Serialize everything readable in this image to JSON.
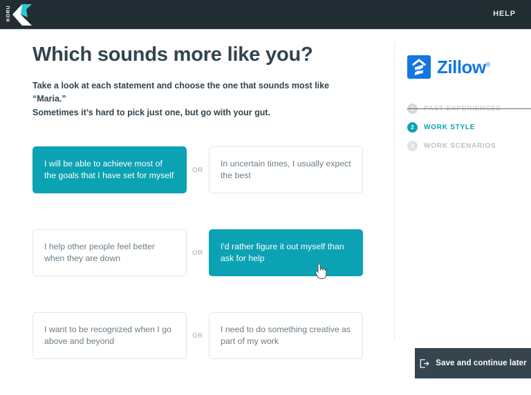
{
  "topbar": {
    "logo_name": "koru-logo",
    "logo_text": "KORU",
    "help_label": "HELP"
  },
  "main": {
    "title": "Which sounds more like you?",
    "subtitle_line1": "Take a look at each statement and choose the one that sounds most like “Maria.”",
    "subtitle_line2": "Sometimes it’s hard to pick just one, but go with your gut.",
    "or_label": "OR",
    "rows": [
      {
        "left": {
          "text": "I will be able to achieve most of the goals that I have set for myself",
          "selected": true
        },
        "right": {
          "text": "In uncertain times, I usually expect the best",
          "selected": false
        }
      },
      {
        "left": {
          "text": "I help other people feel better when they are down",
          "selected": false
        },
        "right": {
          "text": "I'd rather figure it out myself than ask for help",
          "selected": true
        }
      },
      {
        "left": {
          "text": "I want to be recognized when I go above and beyond",
          "selected": false
        },
        "right": {
          "text": "I need to do something creative as part of my work",
          "selected": false
        }
      }
    ]
  },
  "sidebar": {
    "brand_name": "Zillow",
    "brand_registered": "®",
    "steps": [
      {
        "number": "1",
        "label": "PAST EXPERIENCES",
        "state": "done"
      },
      {
        "number": "2",
        "label": "WORK STYLE",
        "state": "current"
      },
      {
        "number": "3",
        "label": "WORK SCENARIOS",
        "state": "upcoming"
      }
    ]
  },
  "footer": {
    "save_label": "Save and continue later"
  },
  "colors": {
    "accent_teal": "#0ba2b4",
    "header_dark": "#222c33",
    "brand_blue": "#1277e1",
    "text_dark": "#32444e",
    "text_muted": "#6b7c87"
  }
}
